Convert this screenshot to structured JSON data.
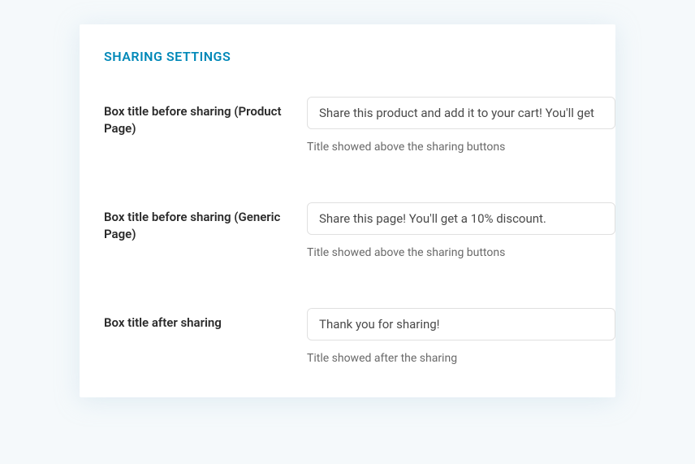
{
  "section_title": "SHARING SETTINGS",
  "fields": {
    "before_product": {
      "label": "Box title before sharing (Product Page)",
      "value": "Share this product and add it to your cart! You'll get",
      "help": "Title showed above the sharing buttons"
    },
    "before_generic": {
      "label": "Box title before sharing (Generic Page)",
      "value": "Share this page! You'll get a 10% discount.",
      "help": "Title showed above the sharing buttons"
    },
    "after": {
      "label": "Box title after sharing",
      "value": "Thank you for sharing!",
      "help": "Title showed after the sharing"
    }
  }
}
